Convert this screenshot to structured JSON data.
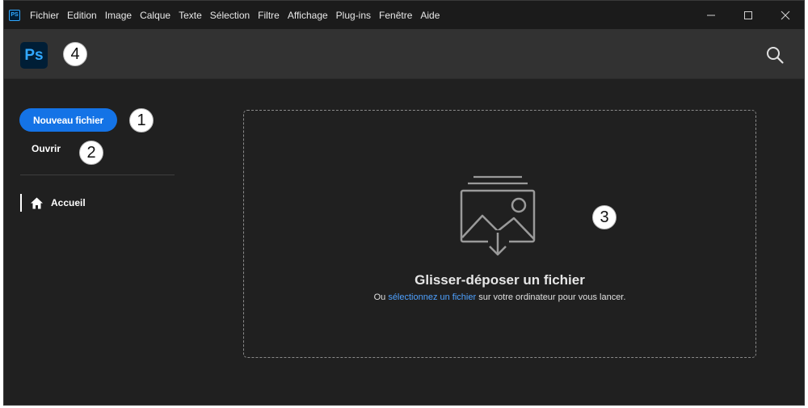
{
  "titlebar": {
    "app_icon": "PS",
    "menu": [
      "Fichier",
      "Edition",
      "Image",
      "Calque",
      "Texte",
      "Sélection",
      "Filtre",
      "Affichage",
      "Plug-ins",
      "Fenêtre",
      "Aide"
    ],
    "controls": [
      "minimize-icon",
      "maximize-icon",
      "close-icon"
    ]
  },
  "header": {
    "logo": "Ps",
    "search_icon": "search-icon"
  },
  "sidebar": {
    "new_file_label": "Nouveau fichier",
    "open_label": "Ouvrir",
    "nav": [
      {
        "label": "Accueil",
        "icon": "home-icon",
        "active": true
      }
    ]
  },
  "dropzone": {
    "icon": "image-stack-download-icon",
    "title": "Glisser-déposer un fichier",
    "sub_prefix": "Ou ",
    "sub_link": "sélectionnez un fichier",
    "sub_suffix": " sur votre ordinateur pour vous lancer."
  },
  "callouts": [
    "1",
    "2",
    "3",
    "4"
  ],
  "colors": {
    "accent": "#1473e6",
    "link": "#4ea1ff",
    "logo_text": "#31a8ff",
    "logo_bg": "#001e36",
    "background": "#202020",
    "header": "#323232"
  }
}
